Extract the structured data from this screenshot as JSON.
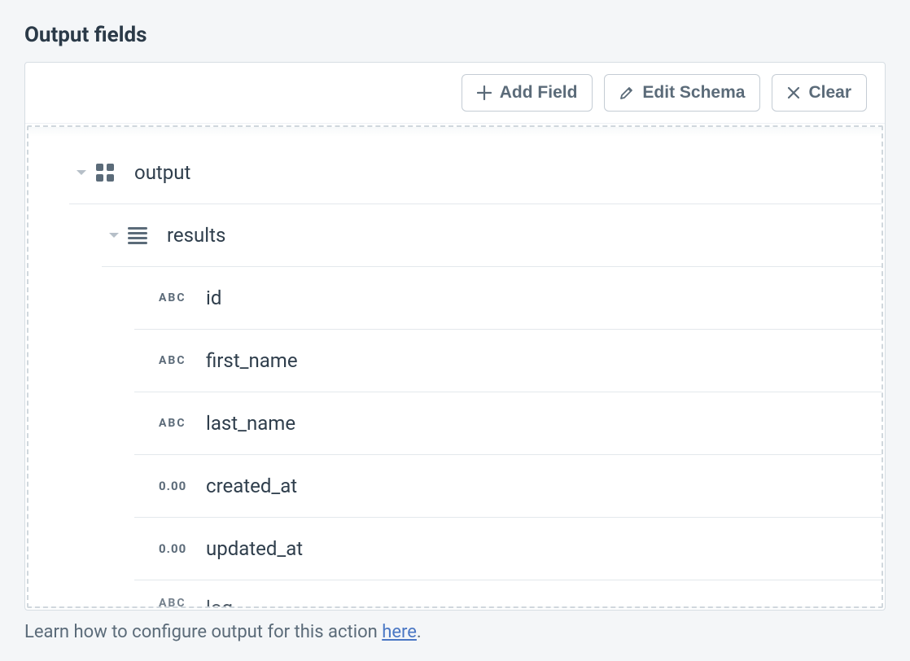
{
  "section_title": "Output fields",
  "toolbar": {
    "add_field": "Add Field",
    "edit_schema": "Edit Schema",
    "clear": "Clear"
  },
  "schema": {
    "root": {
      "name": "output",
      "type": "object"
    },
    "child": {
      "name": "results",
      "type": "array"
    },
    "fields": [
      {
        "name": "id",
        "type_label": "ABC",
        "kind": "string"
      },
      {
        "name": "first_name",
        "type_label": "ABC",
        "kind": "string"
      },
      {
        "name": "last_name",
        "type_label": "ABC",
        "kind": "string"
      },
      {
        "name": "created_at",
        "type_label": "0.00",
        "kind": "number"
      },
      {
        "name": "updated_at",
        "type_label": "0.00",
        "kind": "number"
      }
    ],
    "overflow": {
      "name": "log",
      "type_label": "ABC",
      "kind": "string"
    }
  },
  "caption": {
    "text_before": "Learn how to configure output for this action ",
    "link_text": "here",
    "text_after": "."
  }
}
